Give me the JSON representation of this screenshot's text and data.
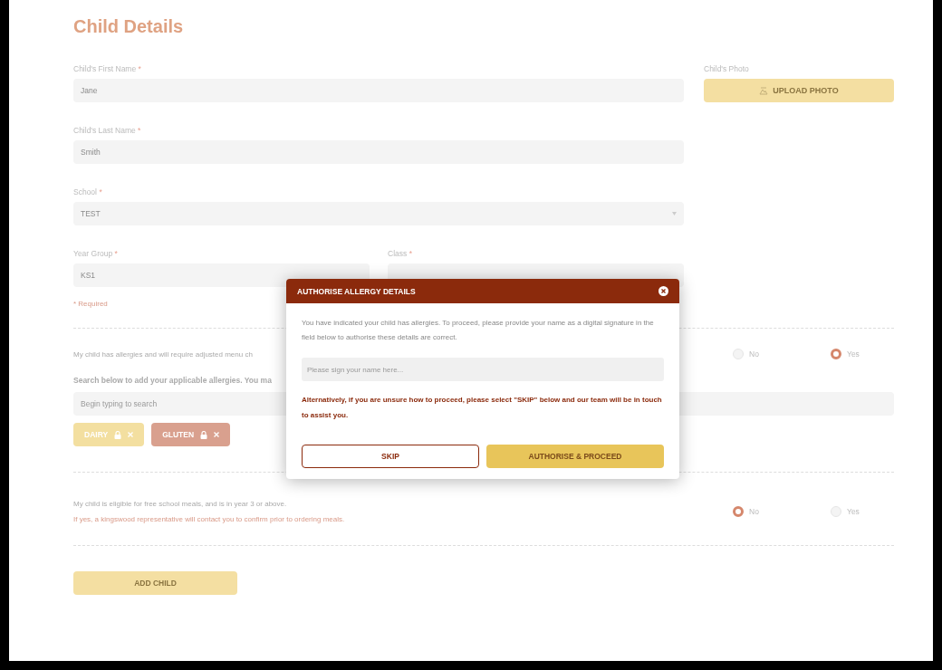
{
  "title": "Child Details",
  "first_name": {
    "label": "Child's First Name",
    "req": "*",
    "value": "Jane"
  },
  "last_name": {
    "label": "Child's Last Name",
    "req": "*",
    "value": "Smith"
  },
  "school": {
    "label": "School",
    "req": "*",
    "value": "TEST"
  },
  "year_group": {
    "label": "Year Group",
    "req": "*",
    "value": "KS1"
  },
  "class_field": {
    "label": "Class",
    "req": "*"
  },
  "photo": {
    "label": "Child's Photo",
    "button": "UPLOAD PHOTO"
  },
  "required_note": "* Required",
  "allergy_question": {
    "text": "My child has allergies and will require adjusted menu ch",
    "options": [
      {
        "label": "No",
        "selected": false
      },
      {
        "label": "Yes",
        "selected": true
      }
    ]
  },
  "allergy_search": {
    "text": "Search below to add your applicable allergies. You ma",
    "placeholder": "Begin typing to search"
  },
  "allergy_tags": [
    {
      "label": "DAIRY",
      "color": "#f3dfa0"
    },
    {
      "label": "GLUTEN",
      "color": "#d9a08e"
    }
  ],
  "meals_question": {
    "text": "My child is eligible for free school meals, and is in year 3 or above.",
    "note": "If yes, a kingswood representative will contact you to confirm prior to ordering meals.",
    "options": [
      {
        "label": "No",
        "selected": true
      },
      {
        "label": "Yes",
        "selected": false
      }
    ]
  },
  "add_button": "ADD CHILD",
  "modal": {
    "title": "AUTHORISE ALLERGY DETAILS",
    "body": "You have indicated your child has allergies. To proceed, please provide your name as a digital signature in the field below to authorise these details are correct.",
    "placeholder": "Please sign your name here...",
    "warning": "Alternatively, if you are unsure how to proceed, please select \"SKIP\" below and our team will be in touch to assist you.",
    "skip": "SKIP",
    "proceed": "AUTHORISE & PROCEED"
  }
}
